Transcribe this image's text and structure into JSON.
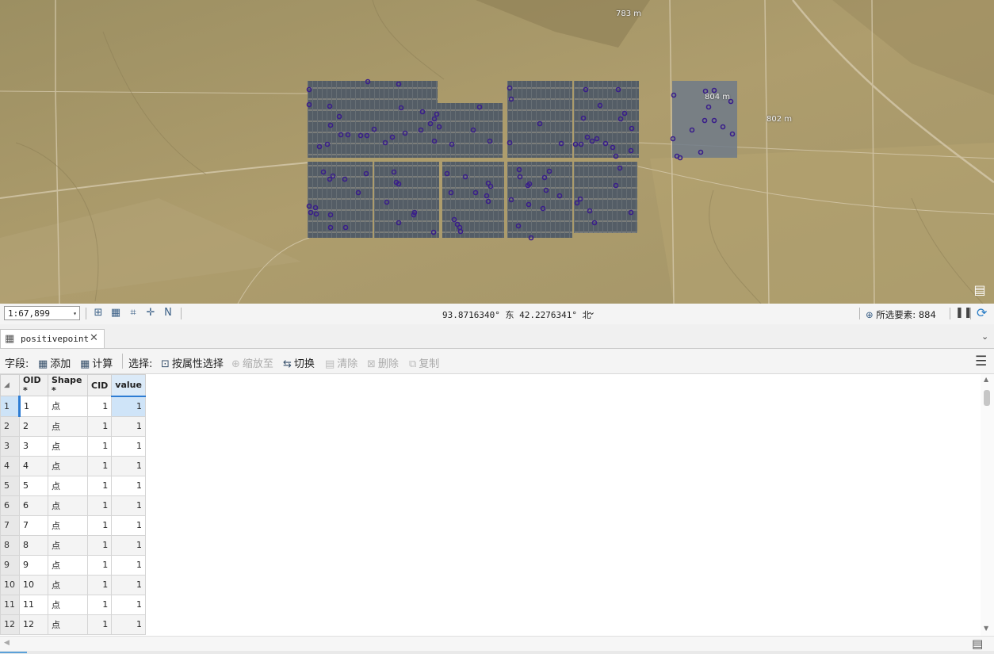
{
  "map": {
    "elevation_labels": [
      "783 m",
      "804 m",
      "802 m"
    ]
  },
  "statusbar": {
    "scale": "1:67,899",
    "coordinates": "93.8716340° 东 42.2276341° 北",
    "selected_features": "所选要素: 884"
  },
  "tab": {
    "title": "positivepoint"
  },
  "toolbar": {
    "field_label": "字段:",
    "add_label": "添加",
    "calculate_label": "计算",
    "selection_label": "选择:",
    "select_by_attr_label": "按属性选择",
    "zoom_to_label": "缩放至",
    "switch_label": "切换",
    "clear_label": "清除",
    "delete_label": "删除",
    "copy_label": "复制"
  },
  "table": {
    "columns": [
      "OID *",
      "Shape *",
      "CID",
      "value"
    ],
    "rows": [
      {
        "rh": "1",
        "oid": "1",
        "shape": "点",
        "cid": "1",
        "value": "1"
      },
      {
        "rh": "2",
        "oid": "2",
        "shape": "点",
        "cid": "1",
        "value": "1"
      },
      {
        "rh": "3",
        "oid": "3",
        "shape": "点",
        "cid": "1",
        "value": "1"
      },
      {
        "rh": "4",
        "oid": "4",
        "shape": "点",
        "cid": "1",
        "value": "1"
      },
      {
        "rh": "5",
        "oid": "5",
        "shape": "点",
        "cid": "1",
        "value": "1"
      },
      {
        "rh": "6",
        "oid": "6",
        "shape": "点",
        "cid": "1",
        "value": "1"
      },
      {
        "rh": "7",
        "oid": "7",
        "shape": "点",
        "cid": "1",
        "value": "1"
      },
      {
        "rh": "8",
        "oid": "8",
        "shape": "点",
        "cid": "1",
        "value": "1"
      },
      {
        "rh": "9",
        "oid": "9",
        "shape": "点",
        "cid": "1",
        "value": "1"
      },
      {
        "rh": "10",
        "oid": "10",
        "shape": "点",
        "cid": "1",
        "value": "1"
      },
      {
        "rh": "11",
        "oid": "11",
        "shape": "点",
        "cid": "1",
        "value": "1"
      },
      {
        "rh": "12",
        "oid": "12",
        "shape": "点",
        "cid": "1",
        "value": "1"
      }
    ]
  },
  "icons": {
    "table_tab": "table-icon",
    "close": "close-icon",
    "legend": "legend-icon",
    "menu": "hamburger-menu-icon",
    "refresh": "refresh-icon",
    "pause": "pause-icon"
  },
  "colors": {
    "map_ground": "#a89868",
    "solar_panels": "#5a6470",
    "points": "#3a1f8a",
    "accent": "#2d7cd3"
  }
}
